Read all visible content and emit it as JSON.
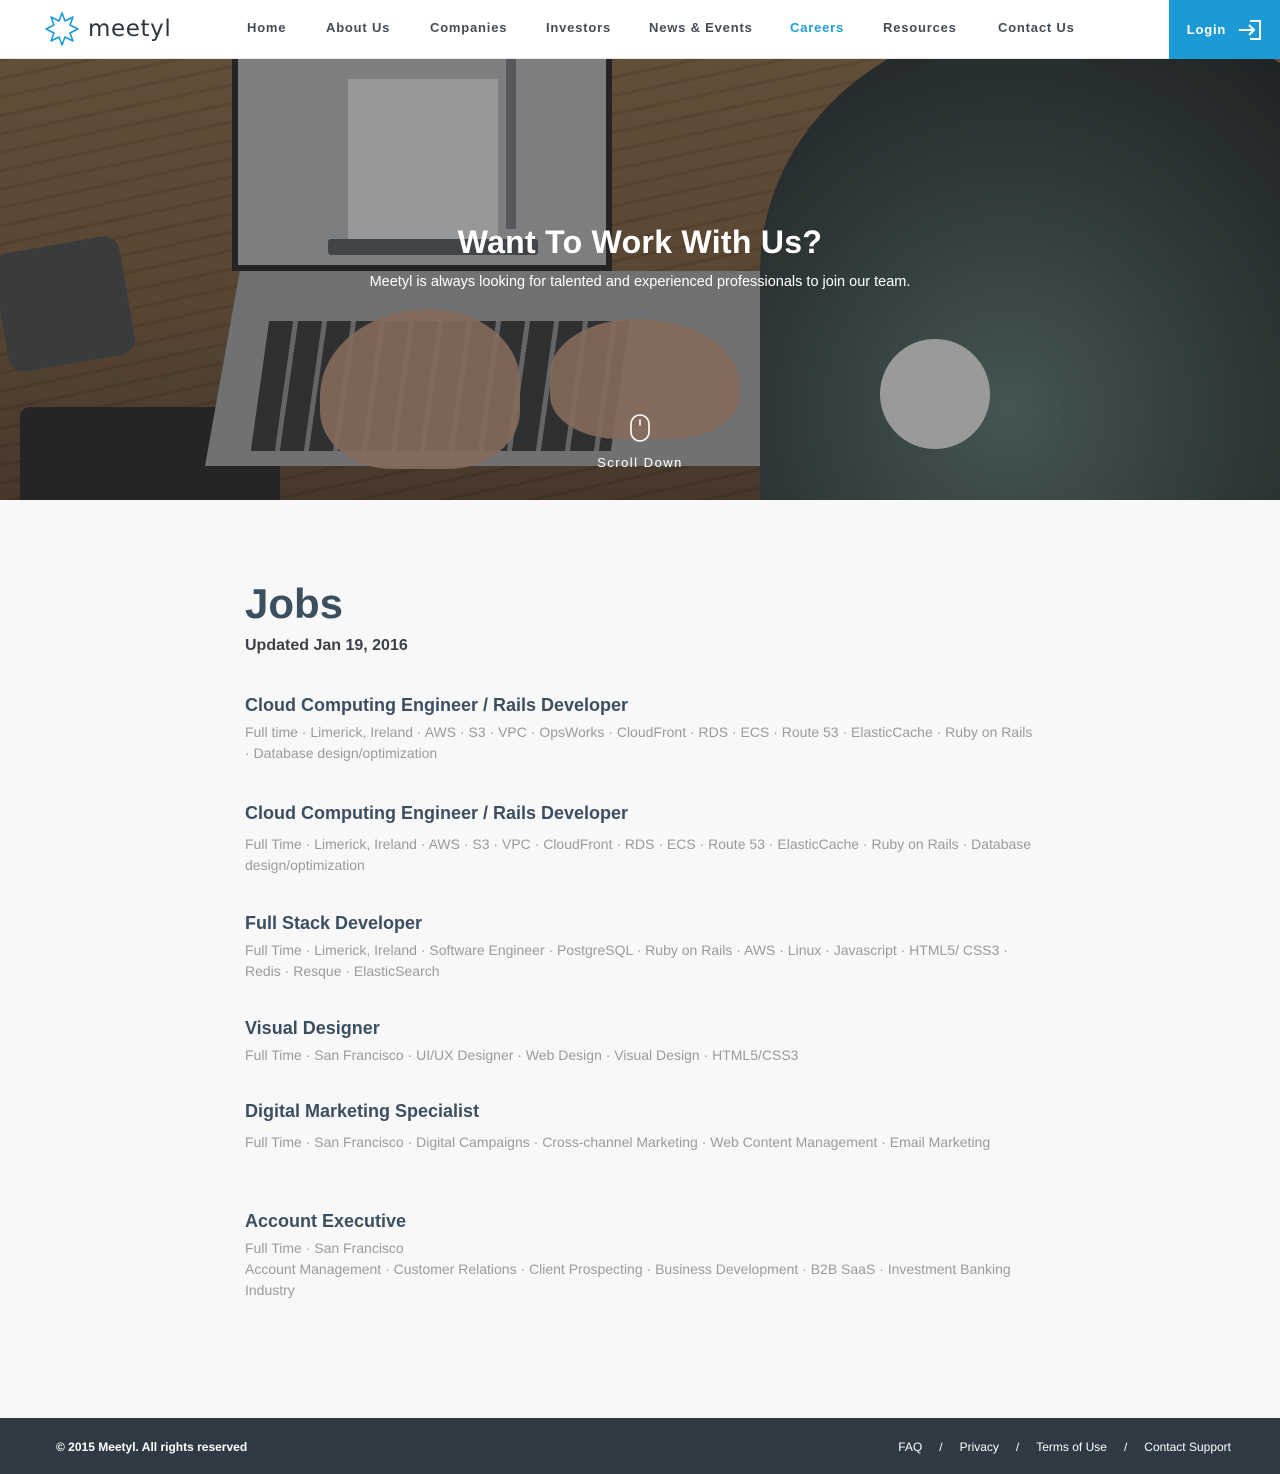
{
  "brand": {
    "name": "meetyl",
    "accent": "#1c9ad6"
  },
  "nav": {
    "items": [
      {
        "label": "Home",
        "active": false
      },
      {
        "label": "About Us",
        "active": false
      },
      {
        "label": "Companies",
        "active": false
      },
      {
        "label": "Investors",
        "active": false
      },
      {
        "label": "News & Events",
        "active": false
      },
      {
        "label": "Careers",
        "active": true
      },
      {
        "label": "Resources",
        "active": false
      },
      {
        "label": "Contact Us",
        "active": false
      }
    ],
    "login_label": "Login",
    "login_icon": "login-arrow-icon"
  },
  "hero": {
    "title": "Want To Work With Us?",
    "subtitle": "Meetyl is always looking for talented and experienced professionals to join our team.",
    "scroll_label": "Scroll Down",
    "scroll_icon": "mouse-icon"
  },
  "jobs": {
    "title": "Jobs",
    "updated": "Updated Jan 19, 2016",
    "list": [
      {
        "title": "Cloud Computing Engineer / Rails Developer",
        "meta": [
          "Full time · Limerick, Ireland · AWS · S3 · VPC · OpsWorks · CloudFront · RDS · ECS · Route 53 · ElasticCache · Ruby on Rails · Database design/optimization"
        ]
      },
      {
        "title": "Cloud Computing Engineer / Rails Developer",
        "meta": [
          "Full Time · Limerick, Ireland · AWS · S3 · VPC · CloudFront · RDS · ECS · Route 53 · ElasticCache · Ruby on Rails · Database design/optimization"
        ]
      },
      {
        "title": "Full Stack Developer",
        "meta": [
          "Full Time · Limerick, Ireland · Software Engineer · PostgreSQL · Ruby on Rails · AWS · Linux · Javascript · HTML5/ CSS3 · Redis · Resque · ElasticSearch"
        ]
      },
      {
        "title": "Visual Designer",
        "meta": [
          "Full Time · San Francisco · UI/UX Designer · Web Design · Visual Design · HTML5/CSS3"
        ]
      },
      {
        "title": "Digital Marketing Specialist",
        "meta": [
          "Full Time · San Francisco · Digital Campaigns · Cross-channel Marketing · Web Content Management · Email Marketing"
        ]
      },
      {
        "title": "Account Executive",
        "meta": [
          "Full Time · San Francisco",
          "Account Management · Customer Relations · Client Prospecting · Business Development · B2B SaaS · Investment Banking Industry"
        ]
      }
    ]
  },
  "footer": {
    "copyright": "© 2015 Meetyl. All rights reserved",
    "links": [
      "FAQ",
      "Privacy",
      "Terms of Use",
      "Contact Support"
    ],
    "separator": "/"
  }
}
